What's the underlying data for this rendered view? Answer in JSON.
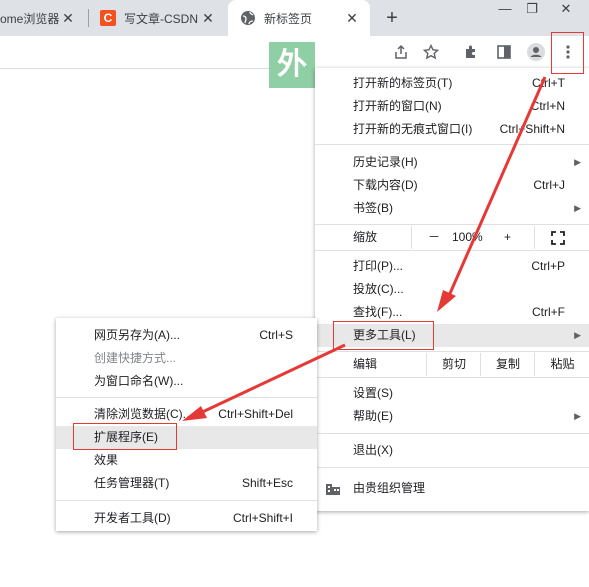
{
  "tabs": [
    {
      "title": "ome浏览器",
      "close": "✕"
    },
    {
      "title": "写文章-CSDN",
      "favicon": "C",
      "close": "✕"
    },
    {
      "title": "新标签页",
      "close": "✕"
    }
  ],
  "newtab": "+",
  "window": {
    "minimize": "—",
    "restore": "❐",
    "close": "✕"
  },
  "watermark": "外",
  "menu": {
    "new_tab": {
      "label": "打开新的标签页(T)",
      "shortcut": "Ctrl+T"
    },
    "new_window": {
      "label": "打开新的窗口(N)",
      "shortcut": "Ctrl+N"
    },
    "incognito": {
      "label": "打开新的无痕式窗口(I)",
      "shortcut": "Ctrl+Shift+N"
    },
    "history": {
      "label": "历史记录(H)"
    },
    "downloads": {
      "label": "下载内容(D)",
      "shortcut": "Ctrl+J"
    },
    "bookmarks": {
      "label": "书签(B)"
    },
    "zoom": {
      "label": "缩放",
      "minus": "－",
      "value": "100%",
      "plus": "+"
    },
    "print": {
      "label": "打印(P)...",
      "shortcut": "Ctrl+P"
    },
    "cast": {
      "label": "投放(C)..."
    },
    "find": {
      "label": "查找(F)...",
      "shortcut": "Ctrl+F"
    },
    "more_tools": {
      "label": "更多工具(L)"
    },
    "edit": {
      "label": "编辑",
      "cut": "剪切",
      "copy": "复制",
      "paste": "粘贴"
    },
    "settings": {
      "label": "设置(S)"
    },
    "help": {
      "label": "帮助(E)"
    },
    "exit": {
      "label": "退出(X)"
    },
    "managed": {
      "label": "由贵组织管理"
    }
  },
  "submenu": {
    "save_page": {
      "label": "网页另存为(A)...",
      "shortcut": "Ctrl+S"
    },
    "create_shortcut": {
      "label": "创建快捷方式..."
    },
    "name_window": {
      "label": "为窗口命名(W)..."
    },
    "clear_data": {
      "label": "清除浏览数据(C)...",
      "shortcut": "Ctrl+Shift+Del"
    },
    "extensions": {
      "label": "扩展程序(E)"
    },
    "performance": {
      "label": "效果"
    },
    "task_manager": {
      "label": "任务管理器(T)",
      "shortcut": "Shift+Esc"
    },
    "dev_tools": {
      "label": "开发者工具(D)",
      "shortcut": "Ctrl+Shift+I"
    }
  },
  "colors": {
    "annotation": "#e53935",
    "highlight": "#e8e8e8",
    "tabstrip": "#dee1e6"
  }
}
